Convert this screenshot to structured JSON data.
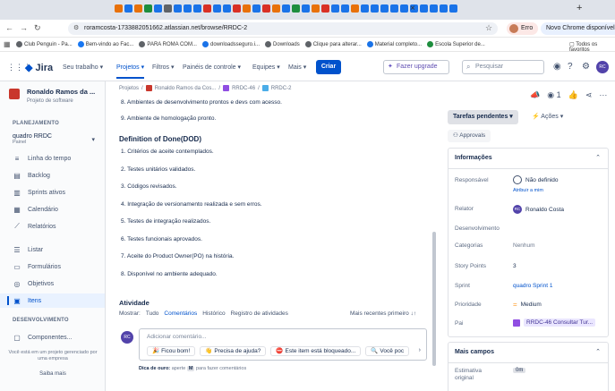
{
  "browser": {
    "tab_colors": [
      "#e8710a",
      "#1a73e8",
      "#e8710a",
      "#1e8e3e",
      "#1a73e8",
      "#5f6368",
      "#1a73e8",
      "#1a73e8",
      "#1a73e8",
      "#d93025",
      "#1a73e8",
      "#1a73e8",
      "#d93025",
      "#e8710a",
      "#1a73e8",
      "#d93025",
      "#e8710a",
      "#1a73e8",
      "#1e8e3e",
      "#1a73e8",
      "#e8710a",
      "#d93025",
      "#1a73e8",
      "#1a73e8",
      "#e8710a",
      "#1a73e8",
      "#1a73e8",
      "#1a73e8",
      "#1a73e8",
      "#1a73e8",
      "#1a73e8",
      "#1a73e8",
      "#1a73e8",
      "#1a73e8",
      "#1a73e8"
    ],
    "url": "roramcosta-1733882051662.atlassian.net/browse/RRDC-2",
    "profile_label": "Erro",
    "chrome_button": "Novo Chrome disponível",
    "bookmarks": [
      {
        "label": "Club Penguin - Pa...",
        "color": "#5f6368"
      },
      {
        "label": "Bem-vindo ao Fac...",
        "color": "#1877f2"
      },
      {
        "label": "PARA ROMA COM...",
        "color": "#5f6368"
      },
      {
        "label": "downloadsseguro.i...",
        "color": "#1a73e8"
      },
      {
        "label": "Downloads",
        "color": "#5f6368"
      },
      {
        "label": "Clique para alterar...",
        "color": "#5f6368"
      },
      {
        "label": "Material completo...",
        "color": "#1a73e8"
      },
      {
        "label": "Escola Superior de...",
        "color": "#1e8e3e"
      }
    ],
    "all_bookmarks": "Todos os favoritos"
  },
  "jira": {
    "logo": "Jira",
    "nav": [
      "Seu trabalho",
      "Projetos",
      "Filtros",
      "Painéis de controle",
      "Equipes",
      "Mais"
    ],
    "create": "Criar",
    "upgrade": "Fazer upgrade",
    "search_placeholder": "Pesquisar",
    "user_initials": "RC"
  },
  "sidebar": {
    "project_name": "Ronaldo Ramos da ...",
    "project_type": "Projeto de software",
    "planning_header": "PLANEJAMENTO",
    "board_name": "quadro RRDC",
    "board_type": "Painel",
    "planning_items": [
      {
        "label": "Linha do tempo",
        "icon": "≡"
      },
      {
        "label": "Backlog",
        "icon": "▤"
      },
      {
        "label": "Sprints ativos",
        "icon": "▥"
      },
      {
        "label": "Calendário",
        "icon": "▦"
      },
      {
        "label": "Relatórios",
        "icon": "⟋"
      }
    ],
    "other_items": [
      {
        "label": "Listar",
        "icon": "☰"
      },
      {
        "label": "Formulários",
        "icon": "▭"
      },
      {
        "label": "Objetivos",
        "icon": "◎"
      },
      {
        "label": "Itens",
        "icon": "▣"
      }
    ],
    "dev_header": "DESENVOLVIMENTO",
    "dev_items": [
      {
        "label": "Componentes...",
        "icon": "▢"
      }
    ],
    "footnote": "Você está em um projeto gerenciado por uma empresa",
    "learn_more": "Saiba mais"
  },
  "main": {
    "breadcrumb": [
      "Projetos",
      "/",
      "Ronaldo Ramos da Cos...",
      "/",
      "RRDC-46",
      "/",
      "RRDC-2"
    ],
    "top_lines": [
      "8. Ambientes de desenvolvimento prontos e devs com acesso.",
      "9. Ambiente de homologação pronto."
    ],
    "dod_title": "Definition of Done(DOD)",
    "dod_lines": [
      "1. Critérios de aceite contemplados.",
      "2. Testes unitários validados.",
      "3. Códigos revisados.",
      "4. Integração de versionamento realizada e sem erros.",
      "5. Testes de integração realizados.",
      "6. Testes funcionais aprovados.",
      "7. Aceite do Product Owner(PO) na história.",
      "8. Disponível no ambiente adequado."
    ],
    "activity_title": "Atividade",
    "show_label": "Mostrar:",
    "filters": [
      "Tudo",
      "Comentários",
      "Histórico",
      "Registro de atividades"
    ],
    "sort_label": "Mais recentes primeiro",
    "comment_placeholder": "Adicionar comentário...",
    "chips": [
      {
        "emoji": "🎉",
        "label": "Ficou bom!"
      },
      {
        "emoji": "👋",
        "label": "Precisa de ajuda?"
      },
      {
        "emoji": "⛔",
        "label": "Este item está bloqueado..."
      },
      {
        "emoji": "🔍",
        "label": "Você poc"
      }
    ],
    "tip_prefix": "Dica de ouro:",
    "tip_mid": "aperte",
    "tip_key": "M",
    "tip_suffix": "para fazer comentários",
    "commenter_initials": "RC"
  },
  "panel": {
    "watch_count": "1",
    "status_button": "Tarefas pendentes",
    "actions": "Ações",
    "approvals": "Approvals",
    "info_header": "Informações",
    "fields": [
      {
        "label": "Responsável",
        "value": "Não definido",
        "sub": "Atribuir a mim"
      },
      {
        "label": "Relator",
        "value": "Ronaldo Costa"
      },
      {
        "label": "Desenvolvimento",
        "value": ""
      },
      {
        "label": "Categorias",
        "value": "Nenhum"
      },
      {
        "label": "Story Points",
        "value": "3"
      },
      {
        "label": "Sprint",
        "value": "quadro Sprint 1"
      },
      {
        "label": "Prioridade",
        "value": "Medium"
      },
      {
        "label": "Pai",
        "value": "RRDC-46 Consultar Tur..."
      }
    ],
    "more_header": "Mais campos",
    "estimate_label": "Estimativa original",
    "estimate_value": "0m"
  }
}
